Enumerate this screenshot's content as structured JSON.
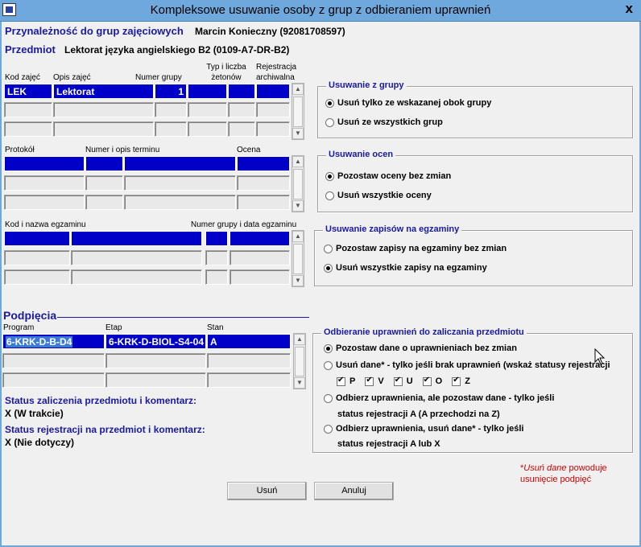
{
  "window": {
    "title": "Kompleksowe usuwanie osoby z grup z odbieraniem uprawnień",
    "close_label": "x"
  },
  "header": {
    "membership_label": "Przynależność do grup zajęciowych",
    "person": "Marcin Konieczny (92081708597)",
    "subject_label": "Przedmiot",
    "subject": "Lektorat języka angielskiego B2 (0109-A7-DR-B2)"
  },
  "groups_table": {
    "headers": [
      "Kod zajęć",
      "Opis zajęć",
      "Numer grupy",
      "Typ i liczba żetonów",
      "Rejestracja archiwalna"
    ],
    "rows": [
      [
        "LEK",
        "Lektorat",
        "1",
        "",
        "",
        ""
      ]
    ]
  },
  "protocols_table": {
    "headers": [
      "Protokół",
      "Numer i opis terminu",
      "Ocena"
    ]
  },
  "exams_table": {
    "headers": [
      "Kod i nazwa egzaminu",
      "Numer grupy i data egzaminu"
    ]
  },
  "subdivisions": {
    "label": "Podpięcia",
    "headers": [
      "Program",
      "Etap",
      "Stan"
    ],
    "rows": [
      [
        "6-KRK-D-B-D4",
        "6-KRK-D-BIOL-S4-04",
        "A"
      ]
    ]
  },
  "status": {
    "completion_label": "Status zaliczenia przedmiotu i komentarz:",
    "completion_value": "X (W trakcie)",
    "registration_label": "Status rejestracji na przedmiot i komentarz:",
    "registration_value": "X (Nie dotyczy)"
  },
  "remove_from_group": {
    "legend": "Usuwanie z grupy",
    "options": [
      "Usuń tylko ze wskazanej obok grupy",
      "Usuń ze wszystkich grup"
    ]
  },
  "remove_grades": {
    "legend": "Usuwanie ocen",
    "options": [
      "Pozostaw oceny bez zmian",
      "Usuń wszystkie oceny"
    ]
  },
  "remove_exam_regs": {
    "legend": "Usuwanie zapisów na egzaminy",
    "options": [
      "Pozostaw zapisy na egzaminy bez zmian",
      "Usuń wszystkie zapisy na egzaminy"
    ]
  },
  "revoke": {
    "legend": "Odbieranie uprawnień do zaliczania przedmiotu",
    "opt1": "Pozostaw dane o uprawnieniach bez zmian",
    "opt2": "Usuń dane* - tylko jeśli brak uprawnień (wskaż statusy rejestracji",
    "checks": [
      "P",
      "V",
      "U",
      "O",
      "Z"
    ],
    "opt3_line1": "Odbierz uprawnienia, ale pozostaw dane - tylko jeśli",
    "opt3_line2": "status rejestracji A (A przechodzi na Z)",
    "opt4_line1": "Odbierz uprawnienia, usuń dane* - tylko jeśli",
    "opt4_line2": "status rejestracji A lub X"
  },
  "note": {
    "star": "*",
    "emph": "Usuń dane",
    "line1_rest": " powoduje",
    "line2": "usunięcie podpięć"
  },
  "buttons": {
    "delete": "Usuń",
    "cancel": "Anuluj"
  }
}
